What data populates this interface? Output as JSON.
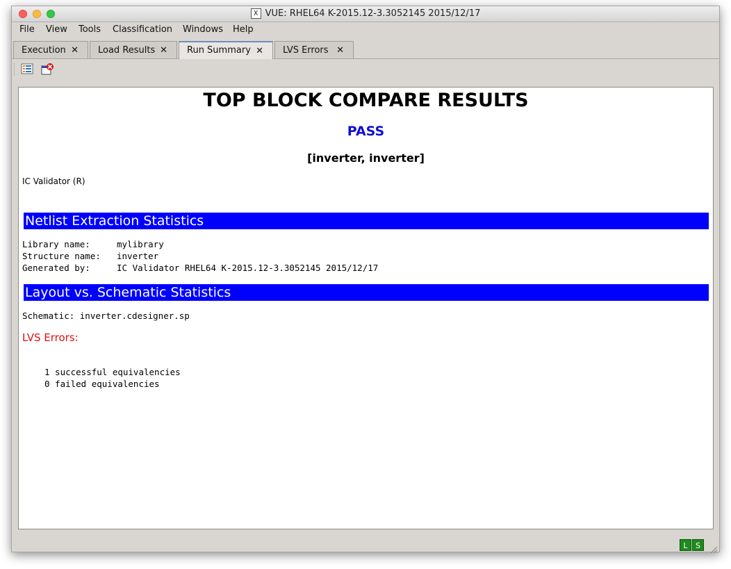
{
  "window": {
    "title": "VUE:  RHEL64 K-2015.12-3.3052145 2015/12/17"
  },
  "menu": [
    "File",
    "View",
    "Tools",
    "Classification",
    "Windows",
    "Help"
  ],
  "tabs": [
    {
      "label": "Execution",
      "active": false
    },
    {
      "label": "Load Results",
      "active": false
    },
    {
      "label": "Run Summary",
      "active": true
    },
    {
      "label": "LVS Errors",
      "active": false
    }
  ],
  "toolbar": {
    "icons": [
      "list-icon",
      "error-report-icon"
    ]
  },
  "summary": {
    "title": "TOP BLOCK COMPARE RESULTS",
    "status": "PASS",
    "cells": "[inverter, inverter]",
    "tool": "IC Validator (R)",
    "netlist_section": {
      "heading": "Netlist Extraction Statistics",
      "rows": [
        {
          "label": "Library name:",
          "value": "mylibrary"
        },
        {
          "label": "Structure name:",
          "value": "inverter"
        },
        {
          "label": "Generated by:",
          "value": "IC Validator RHEL64 K-2015.12-3.3052145 2015/12/17"
        }
      ]
    },
    "lvs_section": {
      "heading": "Layout vs. Schematic Statistics",
      "schematic": "Schematic: inverter.cdesigner.sp",
      "errors_label": "LVS Errors:",
      "successful": "1 successful equivalencies",
      "failed": "0 failed equivalencies"
    }
  },
  "status_indicators": [
    "L",
    "S"
  ],
  "colors": {
    "section_bar": "#0000ff",
    "pass": "#1010d0",
    "errors": "#e01010",
    "indicator": "#1f8a1f"
  }
}
